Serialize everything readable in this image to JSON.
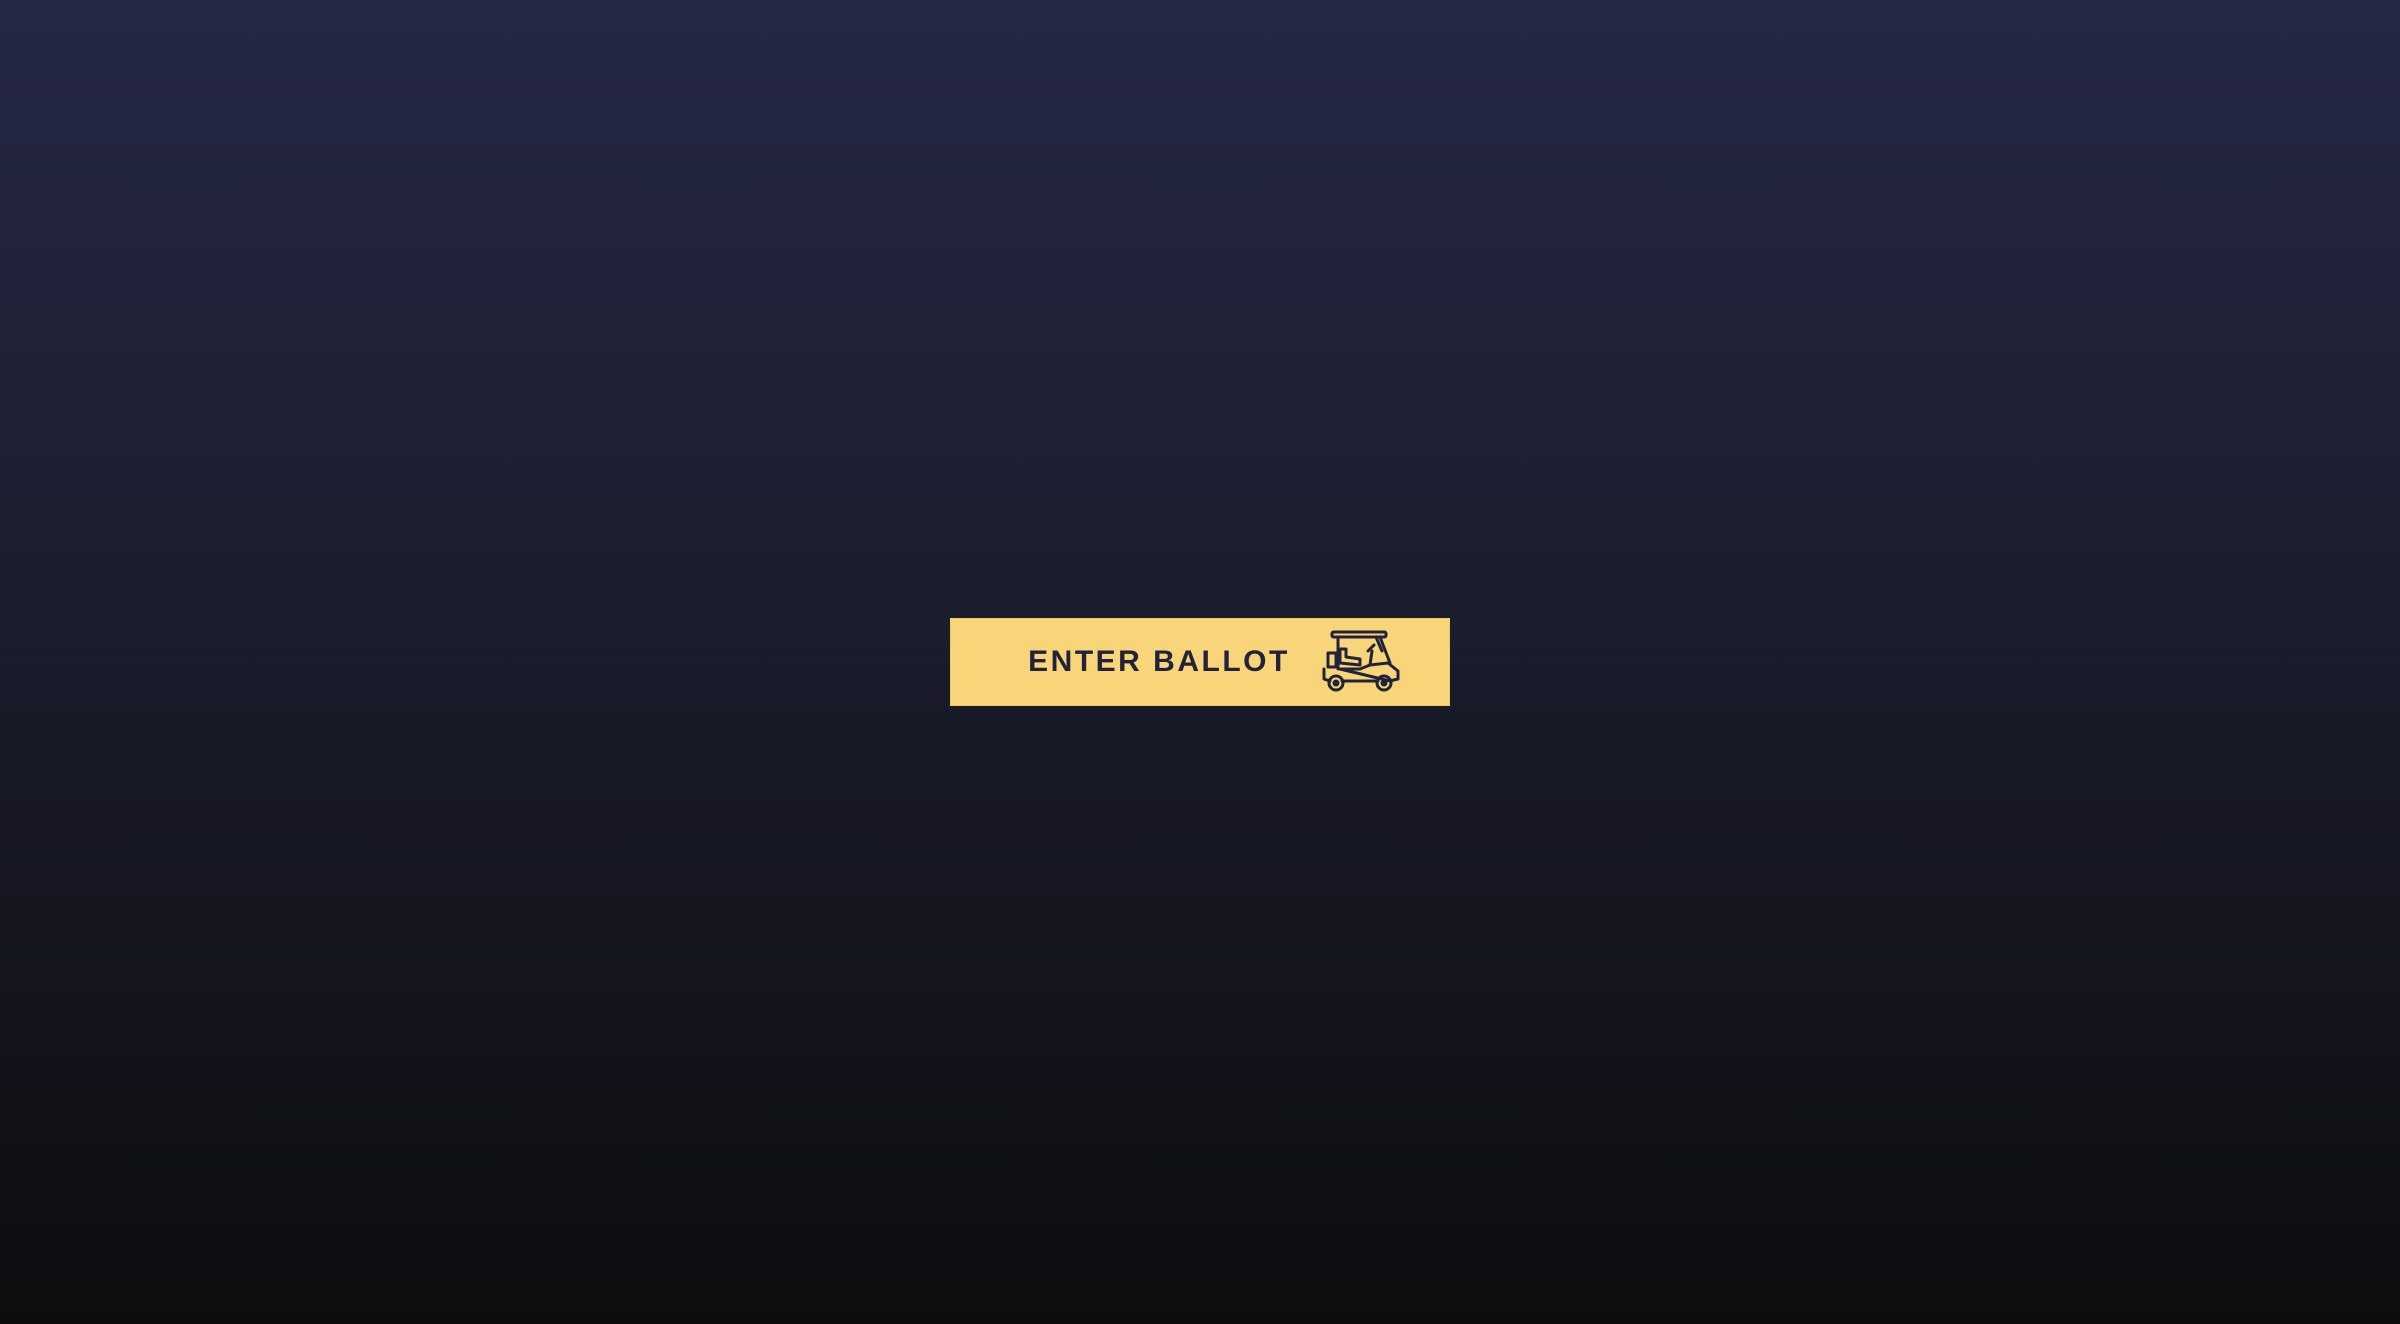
{
  "page": {
    "background_top": "#252845",
    "background_bottom": "#0d0d0f"
  },
  "enter_button": {
    "label": "ENTER BALLOT",
    "icon": "golf-cart-icon",
    "background": "#f9d57a",
    "text_color": "#22233a"
  }
}
